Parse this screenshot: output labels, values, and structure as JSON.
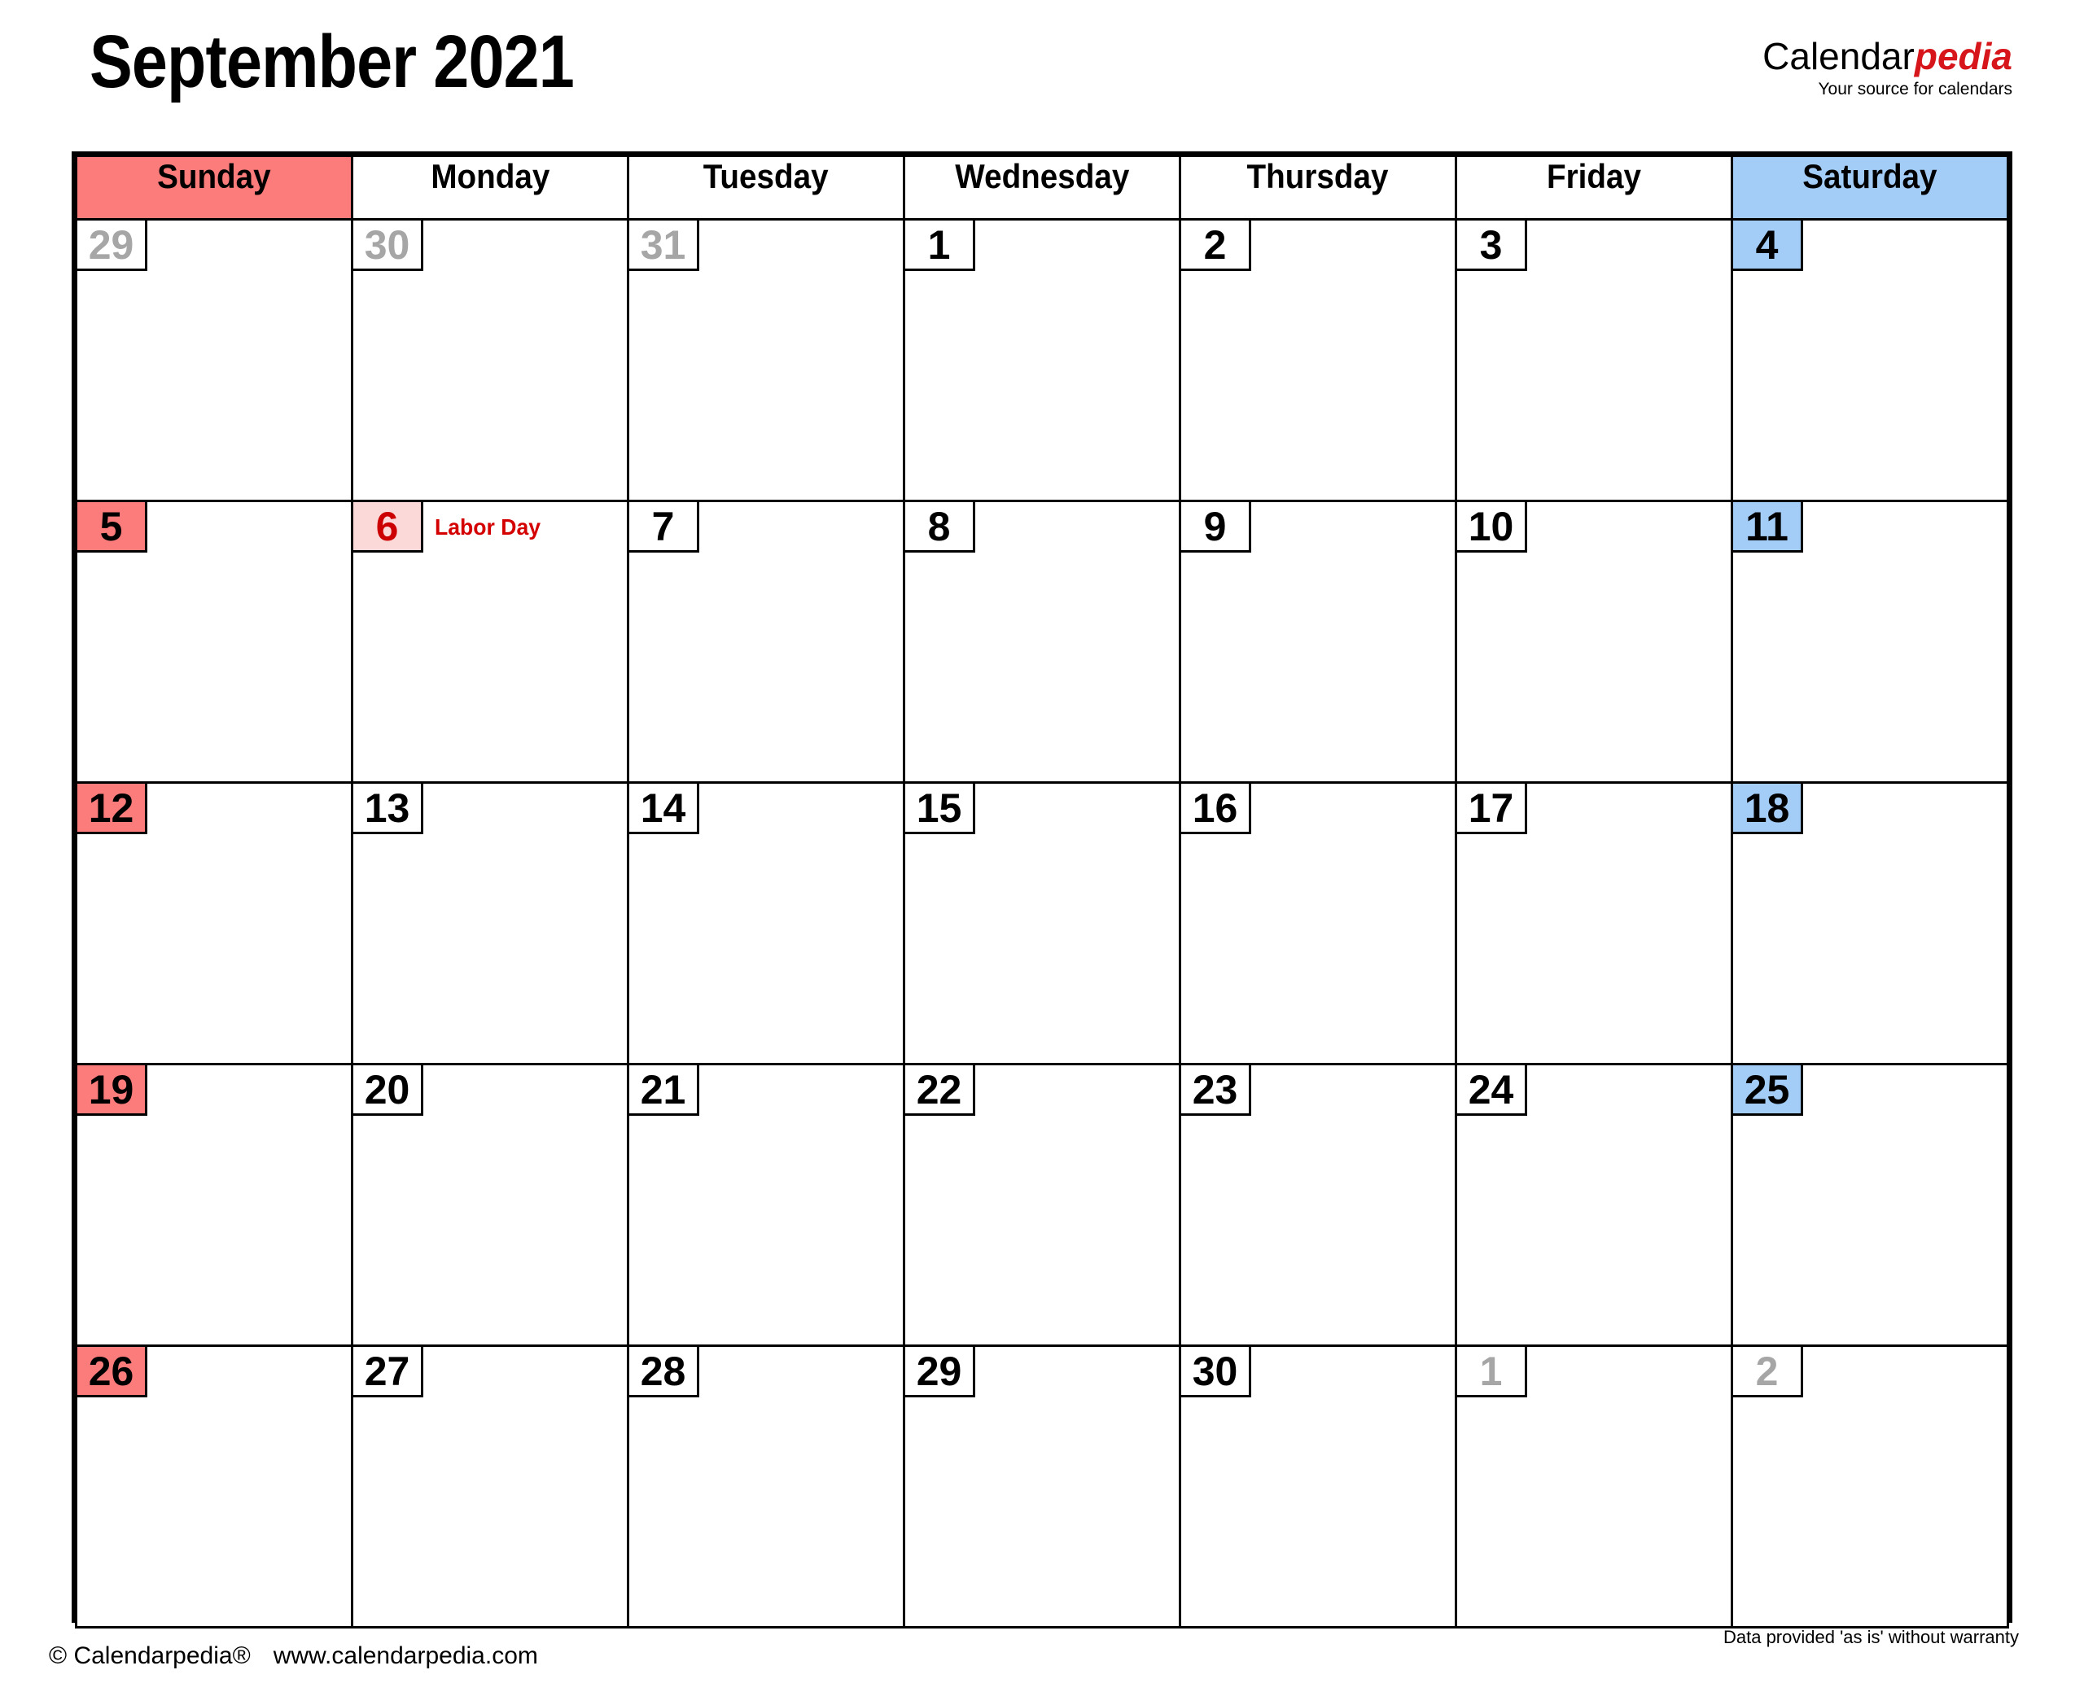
{
  "header": {
    "title": "September 2021",
    "brand_part1": "Calendar",
    "brand_part2": "pedia",
    "brand_tagline": "Your source for calendars",
    "accent_color": "#d7161b"
  },
  "calendar": {
    "weekday_headers": [
      {
        "label": "Sunday",
        "kind": "sun"
      },
      {
        "label": "Monday",
        "kind": "weekday"
      },
      {
        "label": "Tuesday",
        "kind": "weekday"
      },
      {
        "label": "Wednesday",
        "kind": "weekday"
      },
      {
        "label": "Thursday",
        "kind": "weekday"
      },
      {
        "label": "Friday",
        "kind": "weekday"
      },
      {
        "label": "Saturday",
        "kind": "sat"
      }
    ],
    "colors": {
      "sunday_fill": "#fc7b7b",
      "saturday_fill": "#a3cdf7",
      "holiday_fill": "#fbd9d9",
      "holiday_text": "#cc0000",
      "out_of_month_text": "#a6a6a6",
      "grid_line": "#000000"
    },
    "weeks": [
      [
        {
          "day": "29",
          "kind": "out",
          "event": ""
        },
        {
          "day": "30",
          "kind": "out",
          "event": ""
        },
        {
          "day": "31",
          "kind": "out",
          "event": ""
        },
        {
          "day": "1",
          "kind": "weekday",
          "event": ""
        },
        {
          "day": "2",
          "kind": "weekday",
          "event": ""
        },
        {
          "day": "3",
          "kind": "weekday",
          "event": ""
        },
        {
          "day": "4",
          "kind": "sat",
          "event": ""
        }
      ],
      [
        {
          "day": "5",
          "kind": "sun",
          "event": ""
        },
        {
          "day": "6",
          "kind": "hol",
          "event": "Labor Day"
        },
        {
          "day": "7",
          "kind": "weekday",
          "event": ""
        },
        {
          "day": "8",
          "kind": "weekday",
          "event": ""
        },
        {
          "day": "9",
          "kind": "weekday",
          "event": ""
        },
        {
          "day": "10",
          "kind": "weekday",
          "event": ""
        },
        {
          "day": "11",
          "kind": "sat",
          "event": ""
        }
      ],
      [
        {
          "day": "12",
          "kind": "sun",
          "event": ""
        },
        {
          "day": "13",
          "kind": "weekday",
          "event": ""
        },
        {
          "day": "14",
          "kind": "weekday",
          "event": ""
        },
        {
          "day": "15",
          "kind": "weekday",
          "event": ""
        },
        {
          "day": "16",
          "kind": "weekday",
          "event": ""
        },
        {
          "day": "17",
          "kind": "weekday",
          "event": ""
        },
        {
          "day": "18",
          "kind": "sat",
          "event": ""
        }
      ],
      [
        {
          "day": "19",
          "kind": "sun",
          "event": ""
        },
        {
          "day": "20",
          "kind": "weekday",
          "event": ""
        },
        {
          "day": "21",
          "kind": "weekday",
          "event": ""
        },
        {
          "day": "22",
          "kind": "weekday",
          "event": ""
        },
        {
          "day": "23",
          "kind": "weekday",
          "event": ""
        },
        {
          "day": "24",
          "kind": "weekday",
          "event": ""
        },
        {
          "day": "25",
          "kind": "sat",
          "event": ""
        }
      ],
      [
        {
          "day": "26",
          "kind": "sun",
          "event": ""
        },
        {
          "day": "27",
          "kind": "weekday",
          "event": ""
        },
        {
          "day": "28",
          "kind": "weekday",
          "event": ""
        },
        {
          "day": "29",
          "kind": "weekday",
          "event": ""
        },
        {
          "day": "30",
          "kind": "weekday",
          "event": ""
        },
        {
          "day": "1",
          "kind": "out",
          "event": ""
        },
        {
          "day": "2",
          "kind": "out",
          "event": ""
        }
      ]
    ]
  },
  "footer": {
    "copyright": "© Calendarpedia®",
    "website": "www.calendarpedia.com",
    "disclaimer": "Data provided 'as is' without warranty"
  }
}
